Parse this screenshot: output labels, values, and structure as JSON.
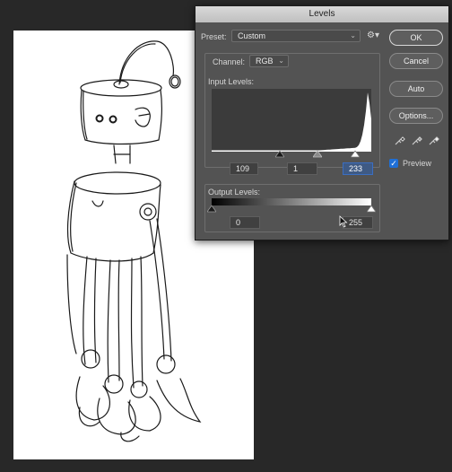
{
  "dialog": {
    "title": "Levels",
    "preset_label": "Preset:",
    "preset_value": "Custom",
    "preset_options_icon": "gear-icon",
    "channel_label": "Channel:",
    "channel_value": "RGB",
    "input_levels_label": "Input Levels:",
    "input_black": "109",
    "input_gamma": "1",
    "input_white": "233",
    "output_levels_label": "Output Levels:",
    "output_black": "0",
    "output_white": "255",
    "preview_label": "Preview",
    "preview_checked": true
  },
  "buttons": {
    "ok": "OK",
    "cancel": "Cancel",
    "auto": "Auto",
    "options": "Options..."
  },
  "histogram": {
    "description_levels": "low counts across midtones, sharp spike near highlights",
    "spike_position": 0.98
  },
  "colors": {
    "dialog_bg": "#535353",
    "selection_blue": "#3a6ec2",
    "canvas_bg": "#282828"
  }
}
